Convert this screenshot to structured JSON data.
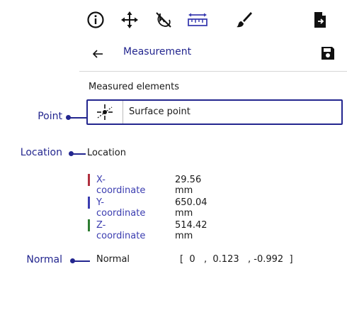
{
  "toolbar": {
    "items": [
      {
        "icon": "info-icon"
      },
      {
        "icon": "move-icon"
      },
      {
        "icon": "no-selection-icon"
      },
      {
        "icon": "measure-ruler-icon",
        "active": true
      },
      {
        "icon": "brush-icon"
      },
      {
        "icon": "export-file-icon"
      }
    ],
    "active_color": "#3b3db0"
  },
  "header": {
    "back_icon": "arrow-left-icon",
    "title": "Measurement",
    "save_icon": "save-icon"
  },
  "measured": {
    "section_label": "Measured elements",
    "element": {
      "icon": "surface-point-icon",
      "name": "Surface point"
    }
  },
  "callouts": {
    "point": "Point",
    "location": "Location",
    "normal": "Normal"
  },
  "location": {
    "label": "Location",
    "coordinates": [
      {
        "name": "X-coordinate",
        "value": "29.56 mm",
        "color": "#b0303f"
      },
      {
        "name": "Y-coordinate",
        "value": "650.04 mm",
        "color": "#3b3db0"
      },
      {
        "name": "Z-coordinate",
        "value": "514.42 mm",
        "color": "#2e7d32"
      }
    ]
  },
  "normal": {
    "label": "Normal",
    "value": "[  0   ,  0.123   , -0.992  ]"
  },
  "colors": {
    "accent": "#23268f"
  }
}
